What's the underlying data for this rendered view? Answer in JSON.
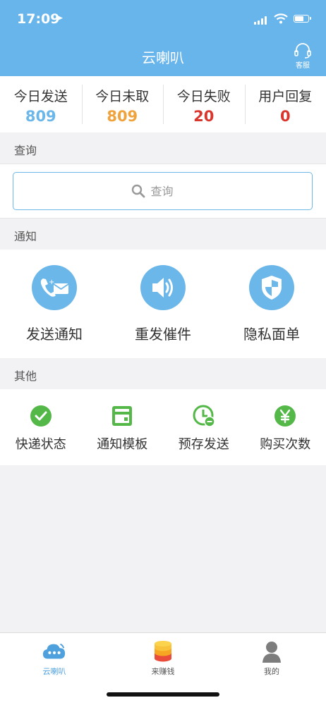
{
  "status_bar": {
    "time": "17:09"
  },
  "header": {
    "title": "云喇叭",
    "service_label": "客服"
  },
  "stats": [
    {
      "label": "今日发送",
      "value": "809",
      "color": "#6cb7ea"
    },
    {
      "label": "今日未取",
      "value": "809",
      "color": "#f0a23c"
    },
    {
      "label": "今日失败",
      "value": "20",
      "color": "#d9362e"
    },
    {
      "label": "用户回复",
      "value": "0",
      "color": "#d9362e"
    }
  ],
  "search": {
    "section_label": "查询",
    "placeholder": "查询"
  },
  "notify": {
    "section_label": "通知",
    "items": [
      {
        "label": "发送通知",
        "icon": "phone-mail-icon"
      },
      {
        "label": "重发催件",
        "icon": "speaker-icon"
      },
      {
        "label": "隐私面单",
        "icon": "shield-icon"
      }
    ]
  },
  "other": {
    "section_label": "其他",
    "items": [
      {
        "label": "快递状态",
        "icon": "check-circle-icon"
      },
      {
        "label": "通知模板",
        "icon": "template-icon"
      },
      {
        "label": "预存发送",
        "icon": "clock-icon"
      },
      {
        "label": "购买次数",
        "icon": "yen-icon"
      }
    ]
  },
  "tabbar": {
    "items": [
      {
        "label": "云喇叭",
        "icon": "cloud-speaker-icon",
        "active": true
      },
      {
        "label": "来赚钱",
        "icon": "coins-icon",
        "active": false
      },
      {
        "label": "我的",
        "icon": "user-icon",
        "active": false
      }
    ]
  },
  "colors": {
    "accent": "#68b5ec",
    "green": "#54b848",
    "orange": "#f0a23c",
    "red": "#d9362e"
  }
}
